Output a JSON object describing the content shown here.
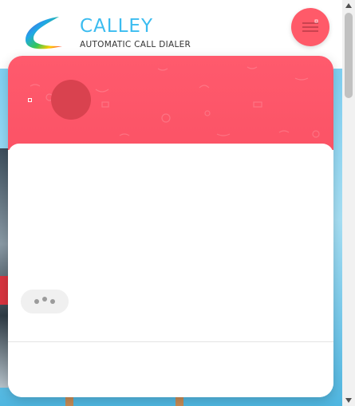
{
  "brand": {
    "title": "CALLEY",
    "subtitle": "AUTOMATIC CALL DIALER"
  },
  "header": {
    "menu_icon": "hamburger-menu-icon"
  },
  "chat_widget": {
    "header_color": "#ff5a69",
    "avatar_icon": "agent-avatar",
    "status": "typing",
    "typing_icon": "typing-dots-icon"
  },
  "colors": {
    "accent": "#ff5a69",
    "brand_blue": "#3bbcf0",
    "scene_sky": "#7fd0f2"
  }
}
